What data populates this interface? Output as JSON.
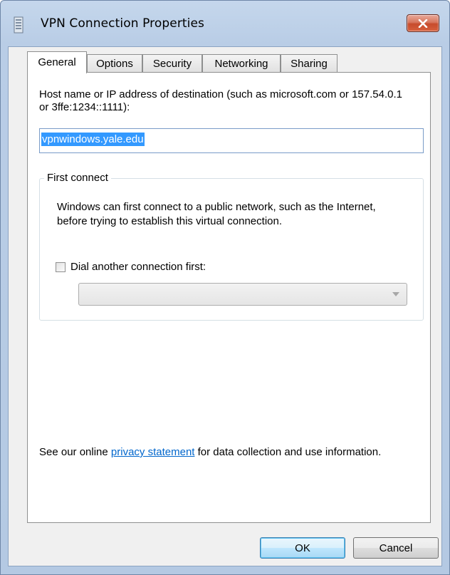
{
  "window": {
    "title": "VPN Connection Properties",
    "accent_close": "#c64b2c"
  },
  "tabs": [
    {
      "label": "General",
      "active": true
    },
    {
      "label": "Options",
      "active": false
    },
    {
      "label": "Security",
      "active": false
    },
    {
      "label": "Networking",
      "active": false
    },
    {
      "label": "Sharing",
      "active": false
    }
  ],
  "general": {
    "host_label": "Host name or IP address of destination (such as microsoft.com or 157.54.0.1 or 3ffe:1234::1111):",
    "host_value": "vpnwindows.yale.edu",
    "first_connect": {
      "legend": "First connect",
      "description": "Windows can first connect to a public network, such as the Internet, before trying to establish this virtual connection.",
      "checkbox_label": "Dial another connection first:",
      "checkbox_checked": false,
      "combo_value": ""
    },
    "privacy": {
      "prefix": "See our online ",
      "link": "privacy statement",
      "suffix": " for data collection and use information."
    }
  },
  "buttons": {
    "ok": "OK",
    "cancel": "Cancel"
  }
}
